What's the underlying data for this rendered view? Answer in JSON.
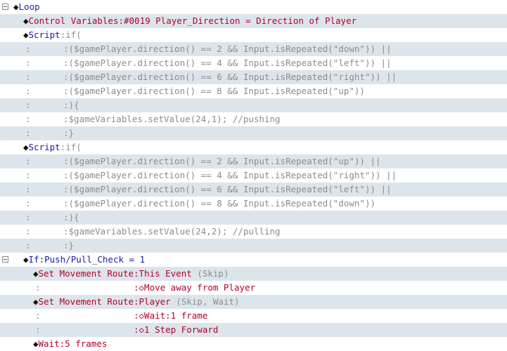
{
  "glyphs": {
    "diamond": "◆",
    "open_diamond": "◇",
    "colon": ":",
    "space": " "
  },
  "rows": [
    {
      "fold": true,
      "indent": 19,
      "parts": [
        {
          "t": "diamond",
          "v": "◆"
        },
        {
          "t": "blue",
          "v": "Loop"
        }
      ]
    },
    {
      "indent": 33,
      "parts": [
        {
          "t": "diamond",
          "v": "◆"
        },
        {
          "t": "red",
          "v": "Control Variables:#0019 Player_Direction = Direction of Player"
        }
      ]
    },
    {
      "indent": 33,
      "parts": [
        {
          "t": "diamond",
          "v": "◆"
        },
        {
          "t": "blue",
          "v": "Script"
        },
        {
          "t": "gray",
          "v": ":if("
        }
      ]
    },
    {
      "cont": 36,
      "indent": 90,
      "parts": [
        {
          "t": "gray",
          "v": ":($gamePlayer.direction() == 2 && Input.isRepeated(\"down\")) ||"
        }
      ]
    },
    {
      "cont": 36,
      "indent": 90,
      "parts": [
        {
          "t": "gray",
          "v": ":($gamePlayer.direction() == 4 && Input.isRepeated(\"left\")) ||"
        }
      ]
    },
    {
      "cont": 36,
      "indent": 90,
      "parts": [
        {
          "t": "gray",
          "v": ":($gamePlayer.direction() == 6 && Input.isRepeated(\"right\")) ||"
        }
      ]
    },
    {
      "cont": 36,
      "indent": 90,
      "parts": [
        {
          "t": "gray",
          "v": ":($gamePlayer.direction() == 8 && Input.isRepeated(\"up\"))"
        }
      ]
    },
    {
      "cont": 36,
      "indent": 90,
      "parts": [
        {
          "t": "gray",
          "v": ":){"
        }
      ]
    },
    {
      "cont": 36,
      "indent": 90,
      "parts": [
        {
          "t": "gray",
          "v": ":$gameVariables.setValue(24,1); //pushing"
        }
      ]
    },
    {
      "cont": 36,
      "indent": 90,
      "parts": [
        {
          "t": "gray",
          "v": ":}"
        }
      ]
    },
    {
      "indent": 33,
      "parts": [
        {
          "t": "diamond",
          "v": "◆"
        },
        {
          "t": "blue",
          "v": "Script"
        },
        {
          "t": "gray",
          "v": ":if("
        }
      ]
    },
    {
      "cont": 36,
      "indent": 90,
      "parts": [
        {
          "t": "gray",
          "v": ":($gamePlayer.direction() == 2 && Input.isRepeated(\"up\")) ||"
        }
      ]
    },
    {
      "cont": 36,
      "indent": 90,
      "parts": [
        {
          "t": "gray",
          "v": ":($gamePlayer.direction() == 4 && Input.isRepeated(\"right\")) ||"
        }
      ]
    },
    {
      "cont": 36,
      "indent": 90,
      "parts": [
        {
          "t": "gray",
          "v": ":($gamePlayer.direction() == 6 && Input.isRepeated(\"left\")) ||"
        }
      ]
    },
    {
      "cont": 36,
      "indent": 90,
      "parts": [
        {
          "t": "gray",
          "v": ":($gamePlayer.direction() == 8 && Input.isRepeated(\"down\"))"
        }
      ]
    },
    {
      "cont": 36,
      "indent": 90,
      "parts": [
        {
          "t": "gray",
          "v": ":){"
        }
      ]
    },
    {
      "cont": 36,
      "indent": 90,
      "parts": [
        {
          "t": "gray",
          "v": ":$gameVariables.setValue(24,2); //pulling"
        }
      ]
    },
    {
      "cont": 36,
      "indent": 90,
      "parts": [
        {
          "t": "gray",
          "v": ":}"
        }
      ]
    },
    {
      "fold": true,
      "indent": 33,
      "parts": [
        {
          "t": "diamond",
          "v": "◆"
        },
        {
          "t": "blue",
          "v": "If:Push/Pull_Check = 1"
        }
      ]
    },
    {
      "indent": 47,
      "parts": [
        {
          "t": "diamond",
          "v": "◆"
        },
        {
          "t": "red",
          "v": "Set Movement Route:This Event "
        },
        {
          "t": "gray",
          "v": "(Skip)"
        }
      ]
    },
    {
      "cont": 50,
      "indent": 190,
      "parts": [
        {
          "t": "red",
          "v": ":◇Move away from Player"
        }
      ]
    },
    {
      "indent": 47,
      "parts": [
        {
          "t": "diamond",
          "v": "◆"
        },
        {
          "t": "red",
          "v": "Set Movement Route:Player "
        },
        {
          "t": "gray",
          "v": "(Skip, Wait)"
        }
      ]
    },
    {
      "cont": 50,
      "indent": 190,
      "parts": [
        {
          "t": "red",
          "v": ":◇Wait:1 frame"
        }
      ]
    },
    {
      "cont": 50,
      "indent": 190,
      "parts": [
        {
          "t": "red",
          "v": ":◇1 Step Forward"
        }
      ]
    },
    {
      "indent": 47,
      "parts": [
        {
          "t": "diamond",
          "v": "◆"
        },
        {
          "t": "red",
          "v": "Wait:5 frames"
        }
      ]
    }
  ],
  "colors": {
    "row_alt": "#dde5ec",
    "command_red": "#b0002a",
    "keyword_blue": "#1a1aa8",
    "script_gray": "#8c8c8c"
  }
}
